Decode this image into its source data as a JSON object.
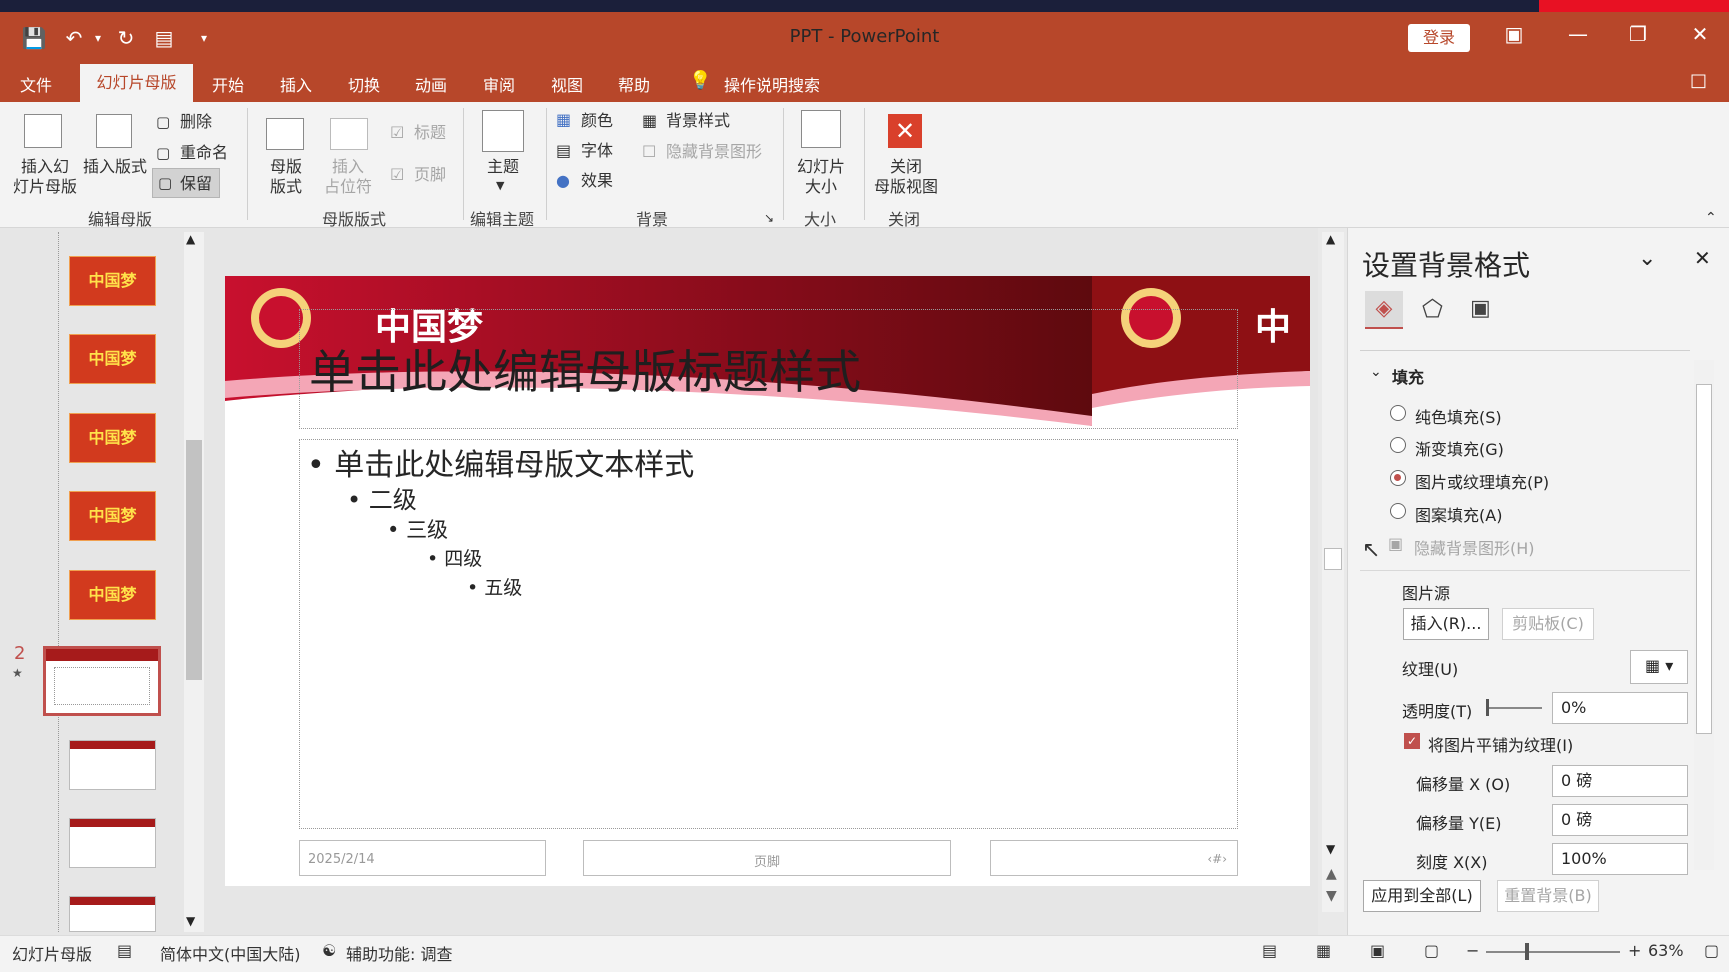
{
  "window": {
    "title": "PPT  -  PowerPoint",
    "login_label": "登录"
  },
  "menu": {
    "file": "文件",
    "active_tab": "幻灯片母版",
    "tabs": [
      "开始",
      "插入",
      "切换",
      "动画",
      "审阅",
      "视图",
      "帮助"
    ],
    "search": "操作说明搜索"
  },
  "ribbon": {
    "insert_master": "插入幻\n灯片母版",
    "insert_layout": "插入版式",
    "delete": "删除",
    "rename": "重命名",
    "preserve": "保留",
    "group_edit_master": "编辑母版",
    "master_layout": "母版\n版式",
    "insert_placeholder": "插入\n占位符",
    "title_check": "标题",
    "footer_check": "页脚",
    "group_master_layout": "母版版式",
    "theme": "主题",
    "group_edit_theme": "编辑主题",
    "colors": "颜色",
    "fonts": "字体",
    "effects": "效果",
    "bg_styles": "背景样式",
    "hide_bg": "隐藏背景图形",
    "group_background": "背景",
    "slide_size": "幻灯片\n大小",
    "group_size": "大小",
    "close_master": "关闭\n母版视图",
    "group_close": "关闭"
  },
  "thumbnails": {
    "thumb_text": "中国梦",
    "selected_number": "2"
  },
  "slide": {
    "banner_text": "中国梦",
    "banner_text_right": "中",
    "title_placeholder": "单击此处编辑母版标题样式",
    "levels": [
      "单击此处编辑母版文本样式",
      "二级",
      "三级",
      "四级",
      "五级"
    ],
    "date": "2025/2/14",
    "footer": "页脚",
    "page_num": "‹#›"
  },
  "panel": {
    "title": "设置背景格式",
    "section_fill": "填充",
    "options": [
      "纯色填充(S)",
      "渐变填充(G)",
      "图片或纹理填充(P)",
      "图案填充(A)"
    ],
    "selected_option": "图片或纹理填充(P)",
    "hide_bg_graphics": "隐藏背景图形(H)",
    "picture_source": "图片源",
    "insert_btn": "插入(R)...",
    "clipboard_btn": "剪贴板(C)",
    "texture": "纹理(U)",
    "transparency_label": "透明度(T)",
    "transparency_value": "0%",
    "tile_label": "将图片平铺为纹理(I)",
    "tile_checked": true,
    "offset_x_label": "偏移量 X (O)",
    "offset_x_value": "0 磅",
    "offset_y_label": "偏移量 Y(E)",
    "offset_y_value": "0 磅",
    "scale_x_label": "刻度 X(X)",
    "scale_x_value": "100%",
    "apply_all": "应用到全部(L)",
    "reset_bg": "重置背景(B)"
  },
  "status": {
    "view": "幻灯片母版",
    "language": "简体中文(中国大陆)",
    "accessibility": "辅助功能: 调查",
    "zoom": "63%"
  },
  "colors": {
    "accent": "#b7472a",
    "banner_dark": "#7a0f12",
    "banner_red": "#c8102e",
    "gold": "#f5d27a"
  }
}
